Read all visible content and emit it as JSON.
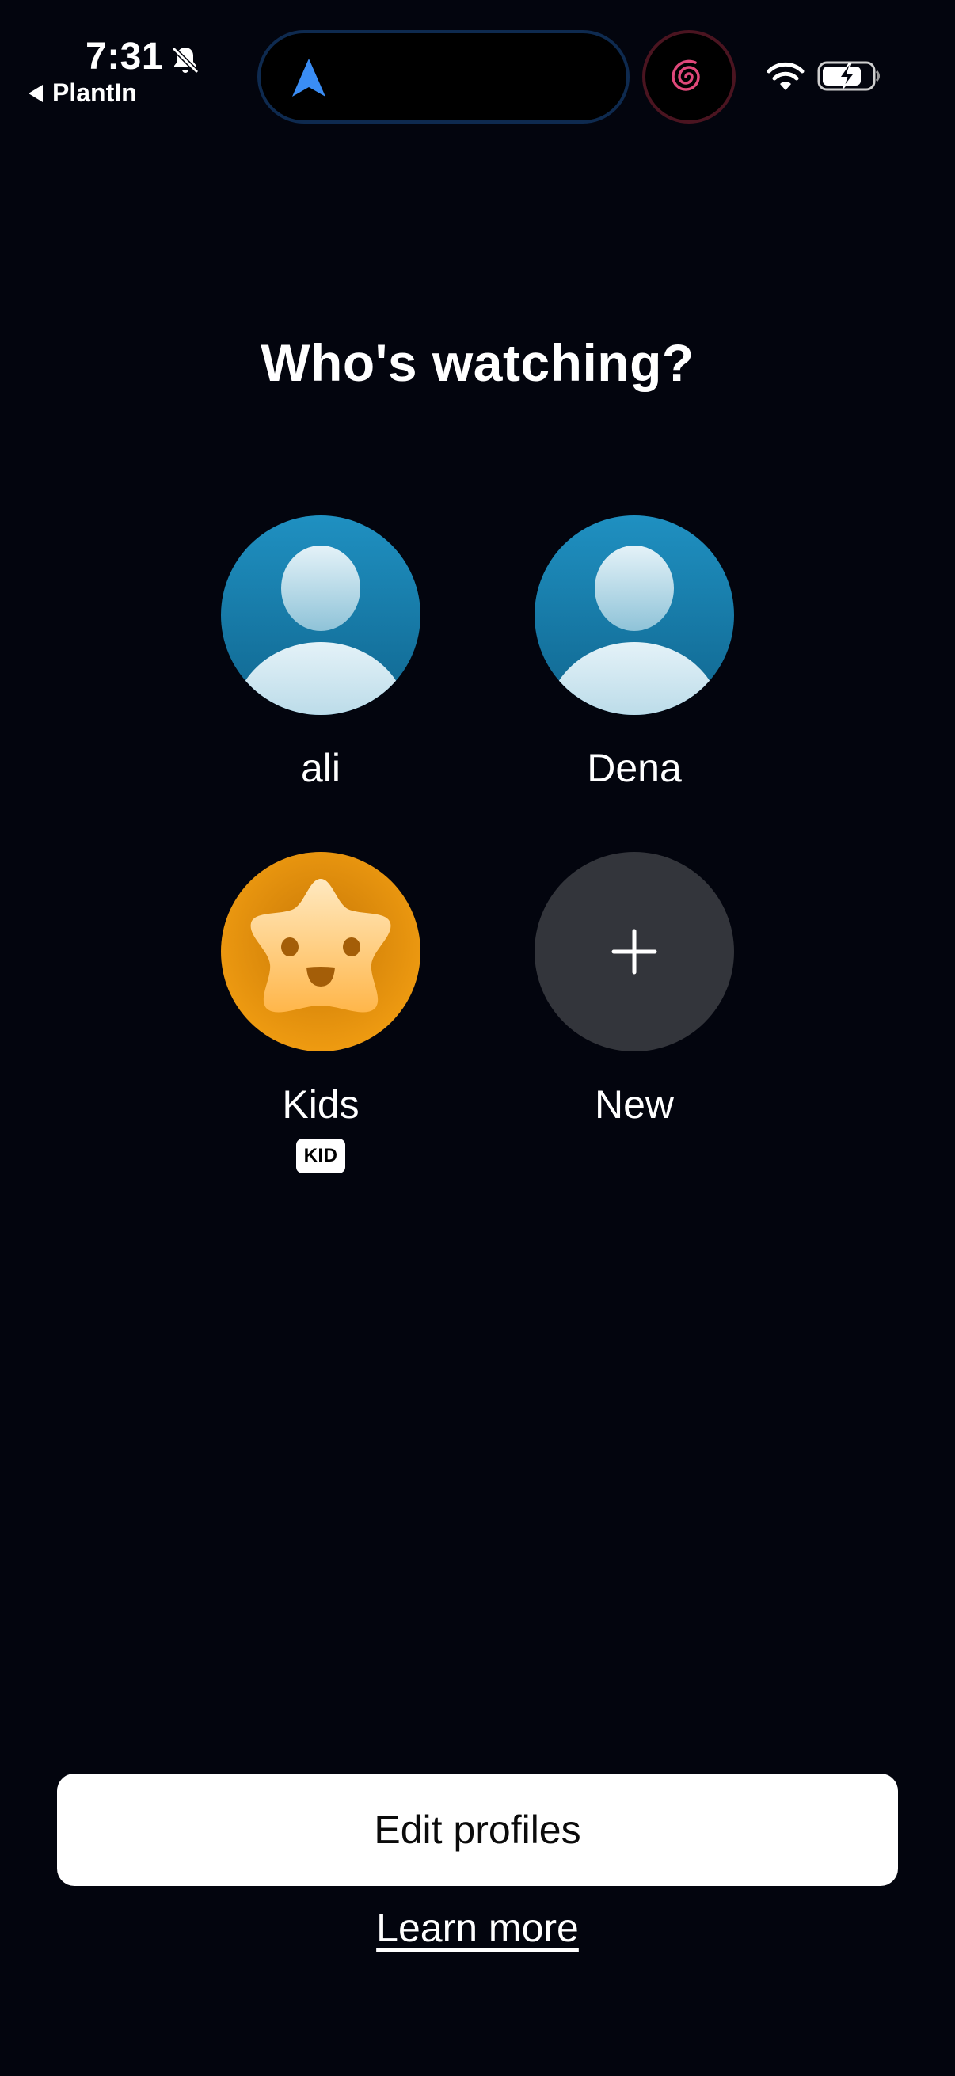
{
  "status_bar": {
    "time": "7:31",
    "back_app": "PlantIn",
    "icons": [
      "bell-slash-icon",
      "navigation-arrow-icon",
      "spiral-app-icon",
      "wifi-icon",
      "battery-charging-icon"
    ]
  },
  "header": {
    "title": "Who's watching?"
  },
  "profiles": [
    {
      "name": "ali",
      "avatar": "person-avatar-icon",
      "color": "#1c88b8"
    },
    {
      "name": "Dena",
      "avatar": "person-avatar-icon",
      "color": "#1c88b8"
    },
    {
      "name": "Kids",
      "avatar": "star-face-avatar-icon",
      "badge": "KID",
      "color": "#f09a0f"
    },
    {
      "name": "New",
      "avatar": "plus-icon",
      "color": "#33353b"
    }
  ],
  "actions": {
    "edit_profiles": "Edit profiles",
    "learn_more": "Learn more"
  },
  "colors": {
    "background": "#03050e",
    "button_bg": "#ffffff",
    "nav_accent": "#3a8df5"
  }
}
